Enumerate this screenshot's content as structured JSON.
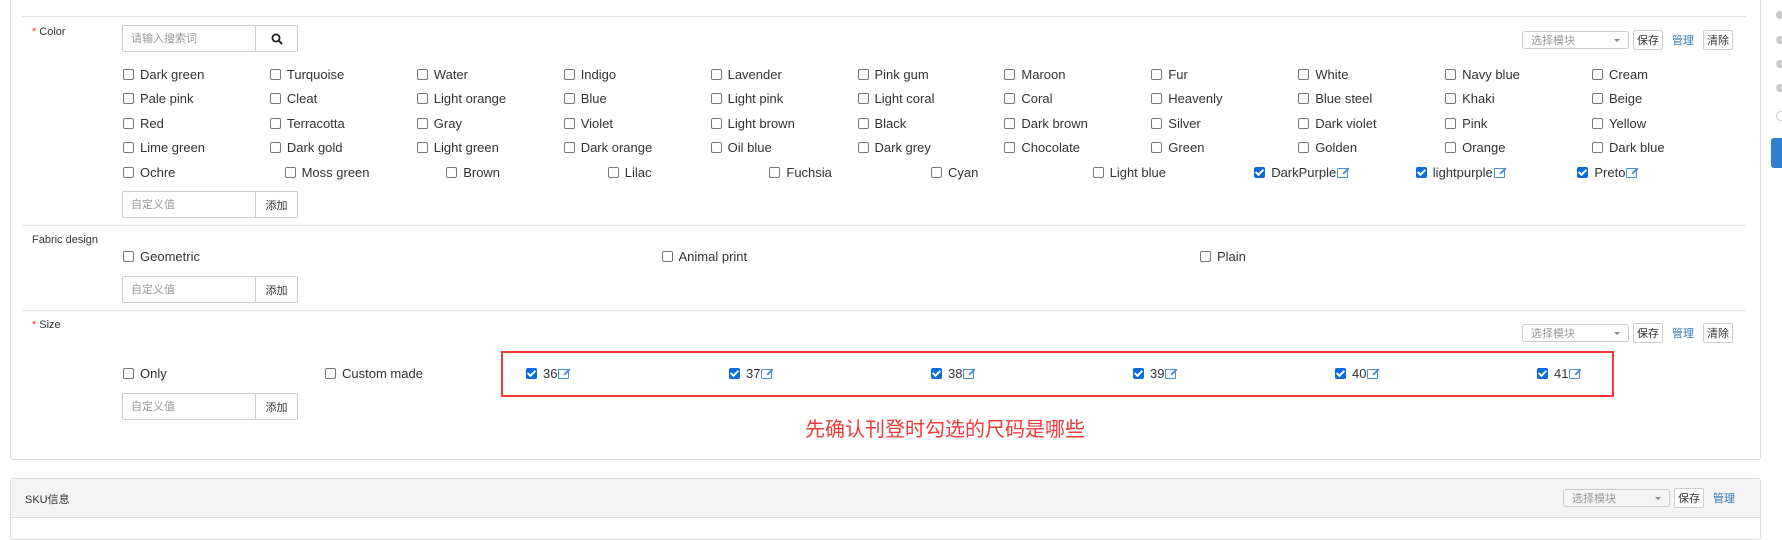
{
  "toolbar": {
    "select_placeholder": "选择模块",
    "save": "保存",
    "manage": "管理",
    "clear": "清除"
  },
  "color": {
    "label": "Color",
    "required_mark": "*",
    "search_placeholder": "请输入搜索词",
    "custom_placeholder": "自定义值",
    "add": "添加",
    "rows": [
      [
        {
          "label": "Dark green",
          "checked": false
        },
        {
          "label": "Turquoise",
          "checked": false
        },
        {
          "label": "Water",
          "checked": false
        },
        {
          "label": "Indigo",
          "checked": false
        },
        {
          "label": "Lavender",
          "checked": false
        },
        {
          "label": "Pink gum",
          "checked": false
        },
        {
          "label": "Maroon",
          "checked": false
        },
        {
          "label": "Fur",
          "checked": false
        },
        {
          "label": "White",
          "checked": false
        },
        {
          "label": "Navy blue",
          "checked": false
        },
        {
          "label": "Cream",
          "checked": false
        }
      ],
      [
        {
          "label": "Pale pink",
          "checked": false
        },
        {
          "label": "Cleat",
          "checked": false
        },
        {
          "label": "Light orange",
          "checked": false
        },
        {
          "label": "Blue",
          "checked": false
        },
        {
          "label": "Light pink",
          "checked": false
        },
        {
          "label": "Light coral",
          "checked": false
        },
        {
          "label": "Coral",
          "checked": false
        },
        {
          "label": "Heavenly",
          "checked": false
        },
        {
          "label": "Blue steel",
          "checked": false
        },
        {
          "label": "Khaki",
          "checked": false
        },
        {
          "label": "Beige",
          "checked": false
        }
      ],
      [
        {
          "label": "Red",
          "checked": false
        },
        {
          "label": "Terracotta",
          "checked": false
        },
        {
          "label": "Gray",
          "checked": false
        },
        {
          "label": "Violet",
          "checked": false
        },
        {
          "label": "Light brown",
          "checked": false
        },
        {
          "label": "Black",
          "checked": false
        },
        {
          "label": "Dark brown",
          "checked": false
        },
        {
          "label": "Silver",
          "checked": false
        },
        {
          "label": "Dark violet",
          "checked": false
        },
        {
          "label": "Pink",
          "checked": false
        },
        {
          "label": "Yellow",
          "checked": false
        }
      ],
      [
        {
          "label": "Lime green",
          "checked": false
        },
        {
          "label": "Dark gold",
          "checked": false
        },
        {
          "label": "Light green",
          "checked": false
        },
        {
          "label": "Dark orange",
          "checked": false
        },
        {
          "label": "Oil blue",
          "checked": false
        },
        {
          "label": "Dark grey",
          "checked": false
        },
        {
          "label": "Chocolate",
          "checked": false
        },
        {
          "label": "Green",
          "checked": false
        },
        {
          "label": "Golden",
          "checked": false
        },
        {
          "label": "Orange",
          "checked": false
        },
        {
          "label": "Dark blue",
          "checked": false
        }
      ],
      [
        {
          "label": "Ochre",
          "checked": false
        },
        {
          "label": "Moss green",
          "checked": false
        },
        {
          "label": "Brown",
          "checked": false
        },
        {
          "label": "Lilac",
          "checked": false
        },
        {
          "label": "Fuchsia",
          "checked": false
        },
        {
          "label": "Cyan",
          "checked": false
        },
        {
          "label": "Light blue",
          "checked": false
        },
        {
          "label": "DarkPurple",
          "checked": true,
          "editable": true
        },
        {
          "label": "lightpurple",
          "checked": true,
          "editable": true
        },
        {
          "label": "Preto",
          "checked": true,
          "editable": true
        }
      ]
    ]
  },
  "fabric": {
    "label": "Fabric design",
    "options": [
      {
        "label": "Geometric",
        "checked": false
      },
      {
        "label": "Animal print",
        "checked": false
      },
      {
        "label": "Plain",
        "checked": false
      }
    ],
    "custom_placeholder": "自定义值",
    "add": "添加"
  },
  "size": {
    "label": "Size",
    "required_mark": "*",
    "options": [
      {
        "label": "Only",
        "checked": false
      },
      {
        "label": "Custom made",
        "checked": false
      },
      {
        "label": "36",
        "checked": true,
        "editable": true
      },
      {
        "label": "37",
        "checked": true,
        "editable": true
      },
      {
        "label": "38",
        "checked": true,
        "editable": true
      },
      {
        "label": "39",
        "checked": true,
        "editable": true
      },
      {
        "label": "40",
        "checked": true,
        "editable": true
      },
      {
        "label": "41",
        "checked": true,
        "editable": true
      }
    ],
    "custom_placeholder": "自定义值",
    "add": "添加",
    "annotation": "先确认刊登时勾选的尺码是哪些"
  },
  "sku": {
    "title": "SKU信息"
  },
  "colors": {
    "accent": "#0b6cdb",
    "annotation": "#f03a3a",
    "link": "#337ab7"
  }
}
